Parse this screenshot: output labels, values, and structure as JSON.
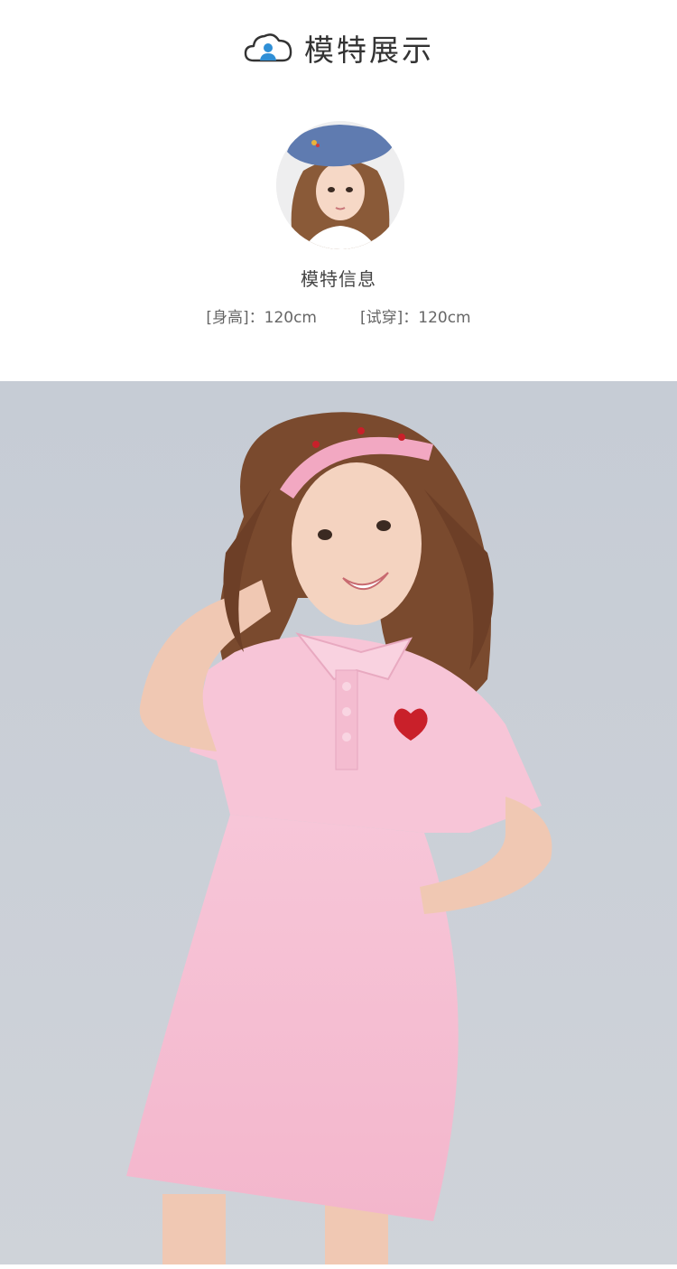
{
  "section": {
    "title": "模特展示",
    "icon": "cloud-person-icon"
  },
  "model_info": {
    "title": "模特信息",
    "height_label": "[身高]：120cm",
    "size_label": "[试穿]：120cm"
  },
  "colors": {
    "background": "#ffffff",
    "backdrop": "#c9ced6",
    "dress": "#f6bfd2",
    "beret": "#5f7bb0",
    "hair": "#7a4a2e"
  }
}
